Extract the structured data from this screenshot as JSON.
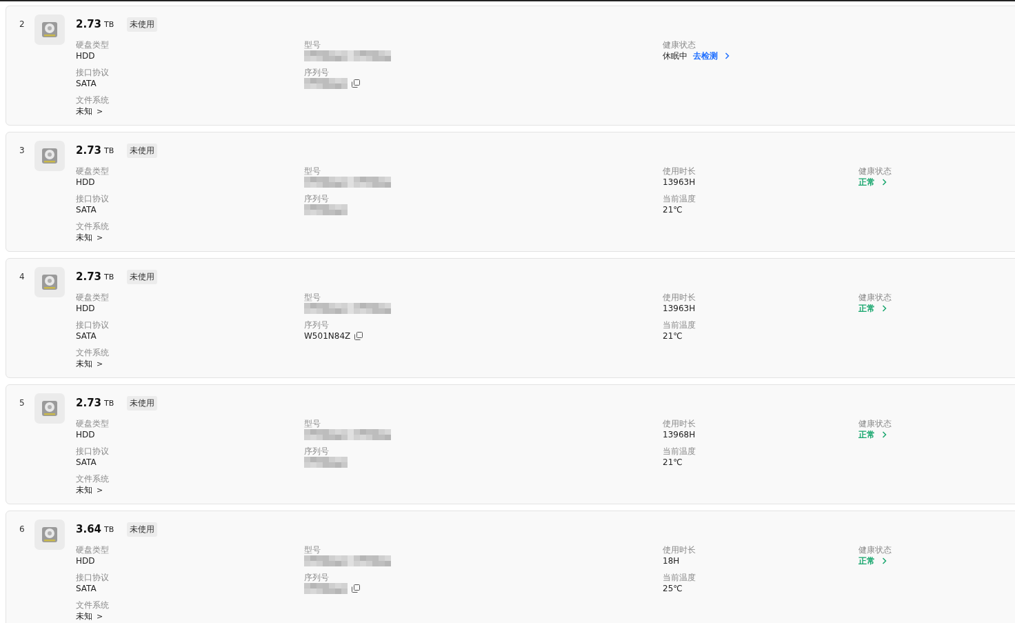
{
  "disks": [
    {
      "index": "2",
      "size": "2.73",
      "unit": "TB",
      "badge": "未使用",
      "fields": [
        {
          "label": "硬盘类型",
          "value": "HDD"
        },
        {
          "label": "接口协议",
          "value": "SATA"
        },
        {
          "label": "文件系统",
          "value": "未知",
          "link": ">"
        }
      ],
      "model": {
        "label": "型号",
        "redacted": true
      },
      "serial": {
        "label": "序列号",
        "redacted": true,
        "copy": true
      },
      "health": {
        "label": "健康状态",
        "kind": "sleeping",
        "status": "休眠中",
        "action": "去检测"
      }
    },
    {
      "index": "3",
      "size": "2.73",
      "unit": "TB",
      "badge": "未使用",
      "fields": [
        {
          "label": "硬盘类型",
          "value": "HDD"
        },
        {
          "label": "接口协议",
          "value": "SATA"
        },
        {
          "label": "文件系统",
          "value": "未知",
          "link": ">"
        }
      ],
      "model": {
        "label": "型号",
        "redacted": true
      },
      "serial": {
        "label": "序列号",
        "redacted": true,
        "copy": false
      },
      "metrics": [
        {
          "label": "使用时长",
          "value": "13963H"
        },
        {
          "label": "当前温度",
          "value": "21℃"
        }
      ],
      "health": {
        "label": "健康状态",
        "kind": "normal",
        "status": "正常"
      }
    },
    {
      "index": "4",
      "size": "2.73",
      "unit": "TB",
      "badge": "未使用",
      "fields": [
        {
          "label": "硬盘类型",
          "value": "HDD"
        },
        {
          "label": "接口协议",
          "value": "SATA"
        },
        {
          "label": "文件系统",
          "value": "未知",
          "link": ">"
        }
      ],
      "model": {
        "label": "型号",
        "redacted": true
      },
      "serial": {
        "label": "序列号",
        "redacted": false,
        "value": "W501N84Z",
        "copy": true
      },
      "metrics": [
        {
          "label": "使用时长",
          "value": "13963H"
        },
        {
          "label": "当前温度",
          "value": "21℃"
        }
      ],
      "health": {
        "label": "健康状态",
        "kind": "normal",
        "status": "正常"
      }
    },
    {
      "index": "5",
      "size": "2.73",
      "unit": "TB",
      "badge": "未使用",
      "fields": [
        {
          "label": "硬盘类型",
          "value": "HDD"
        },
        {
          "label": "接口协议",
          "value": "SATA"
        },
        {
          "label": "文件系统",
          "value": "未知",
          "link": ">"
        }
      ],
      "model": {
        "label": "型号",
        "redacted": true
      },
      "serial": {
        "label": "序列号",
        "redacted": true,
        "copy": false
      },
      "metrics": [
        {
          "label": "使用时长",
          "value": "13968H"
        },
        {
          "label": "当前温度",
          "value": "21℃"
        }
      ],
      "health": {
        "label": "健康状态",
        "kind": "normal",
        "status": "正常"
      }
    },
    {
      "index": "6",
      "size": "3.64",
      "unit": "TB",
      "badge": "未使用",
      "fields": [
        {
          "label": "硬盘类型",
          "value": "HDD"
        },
        {
          "label": "接口协议",
          "value": "SATA"
        },
        {
          "label": "文件系统",
          "value": "未知",
          "link": ">"
        }
      ],
      "model": {
        "label": "型号",
        "redacted": true
      },
      "serial": {
        "label": "序列号",
        "redacted": true,
        "copy": true
      },
      "metrics": [
        {
          "label": "使用时长",
          "value": "18H"
        },
        {
          "label": "当前温度",
          "value": "25℃"
        }
      ],
      "health": {
        "label": "健康状态",
        "kind": "normal",
        "status": "正常"
      }
    }
  ]
}
